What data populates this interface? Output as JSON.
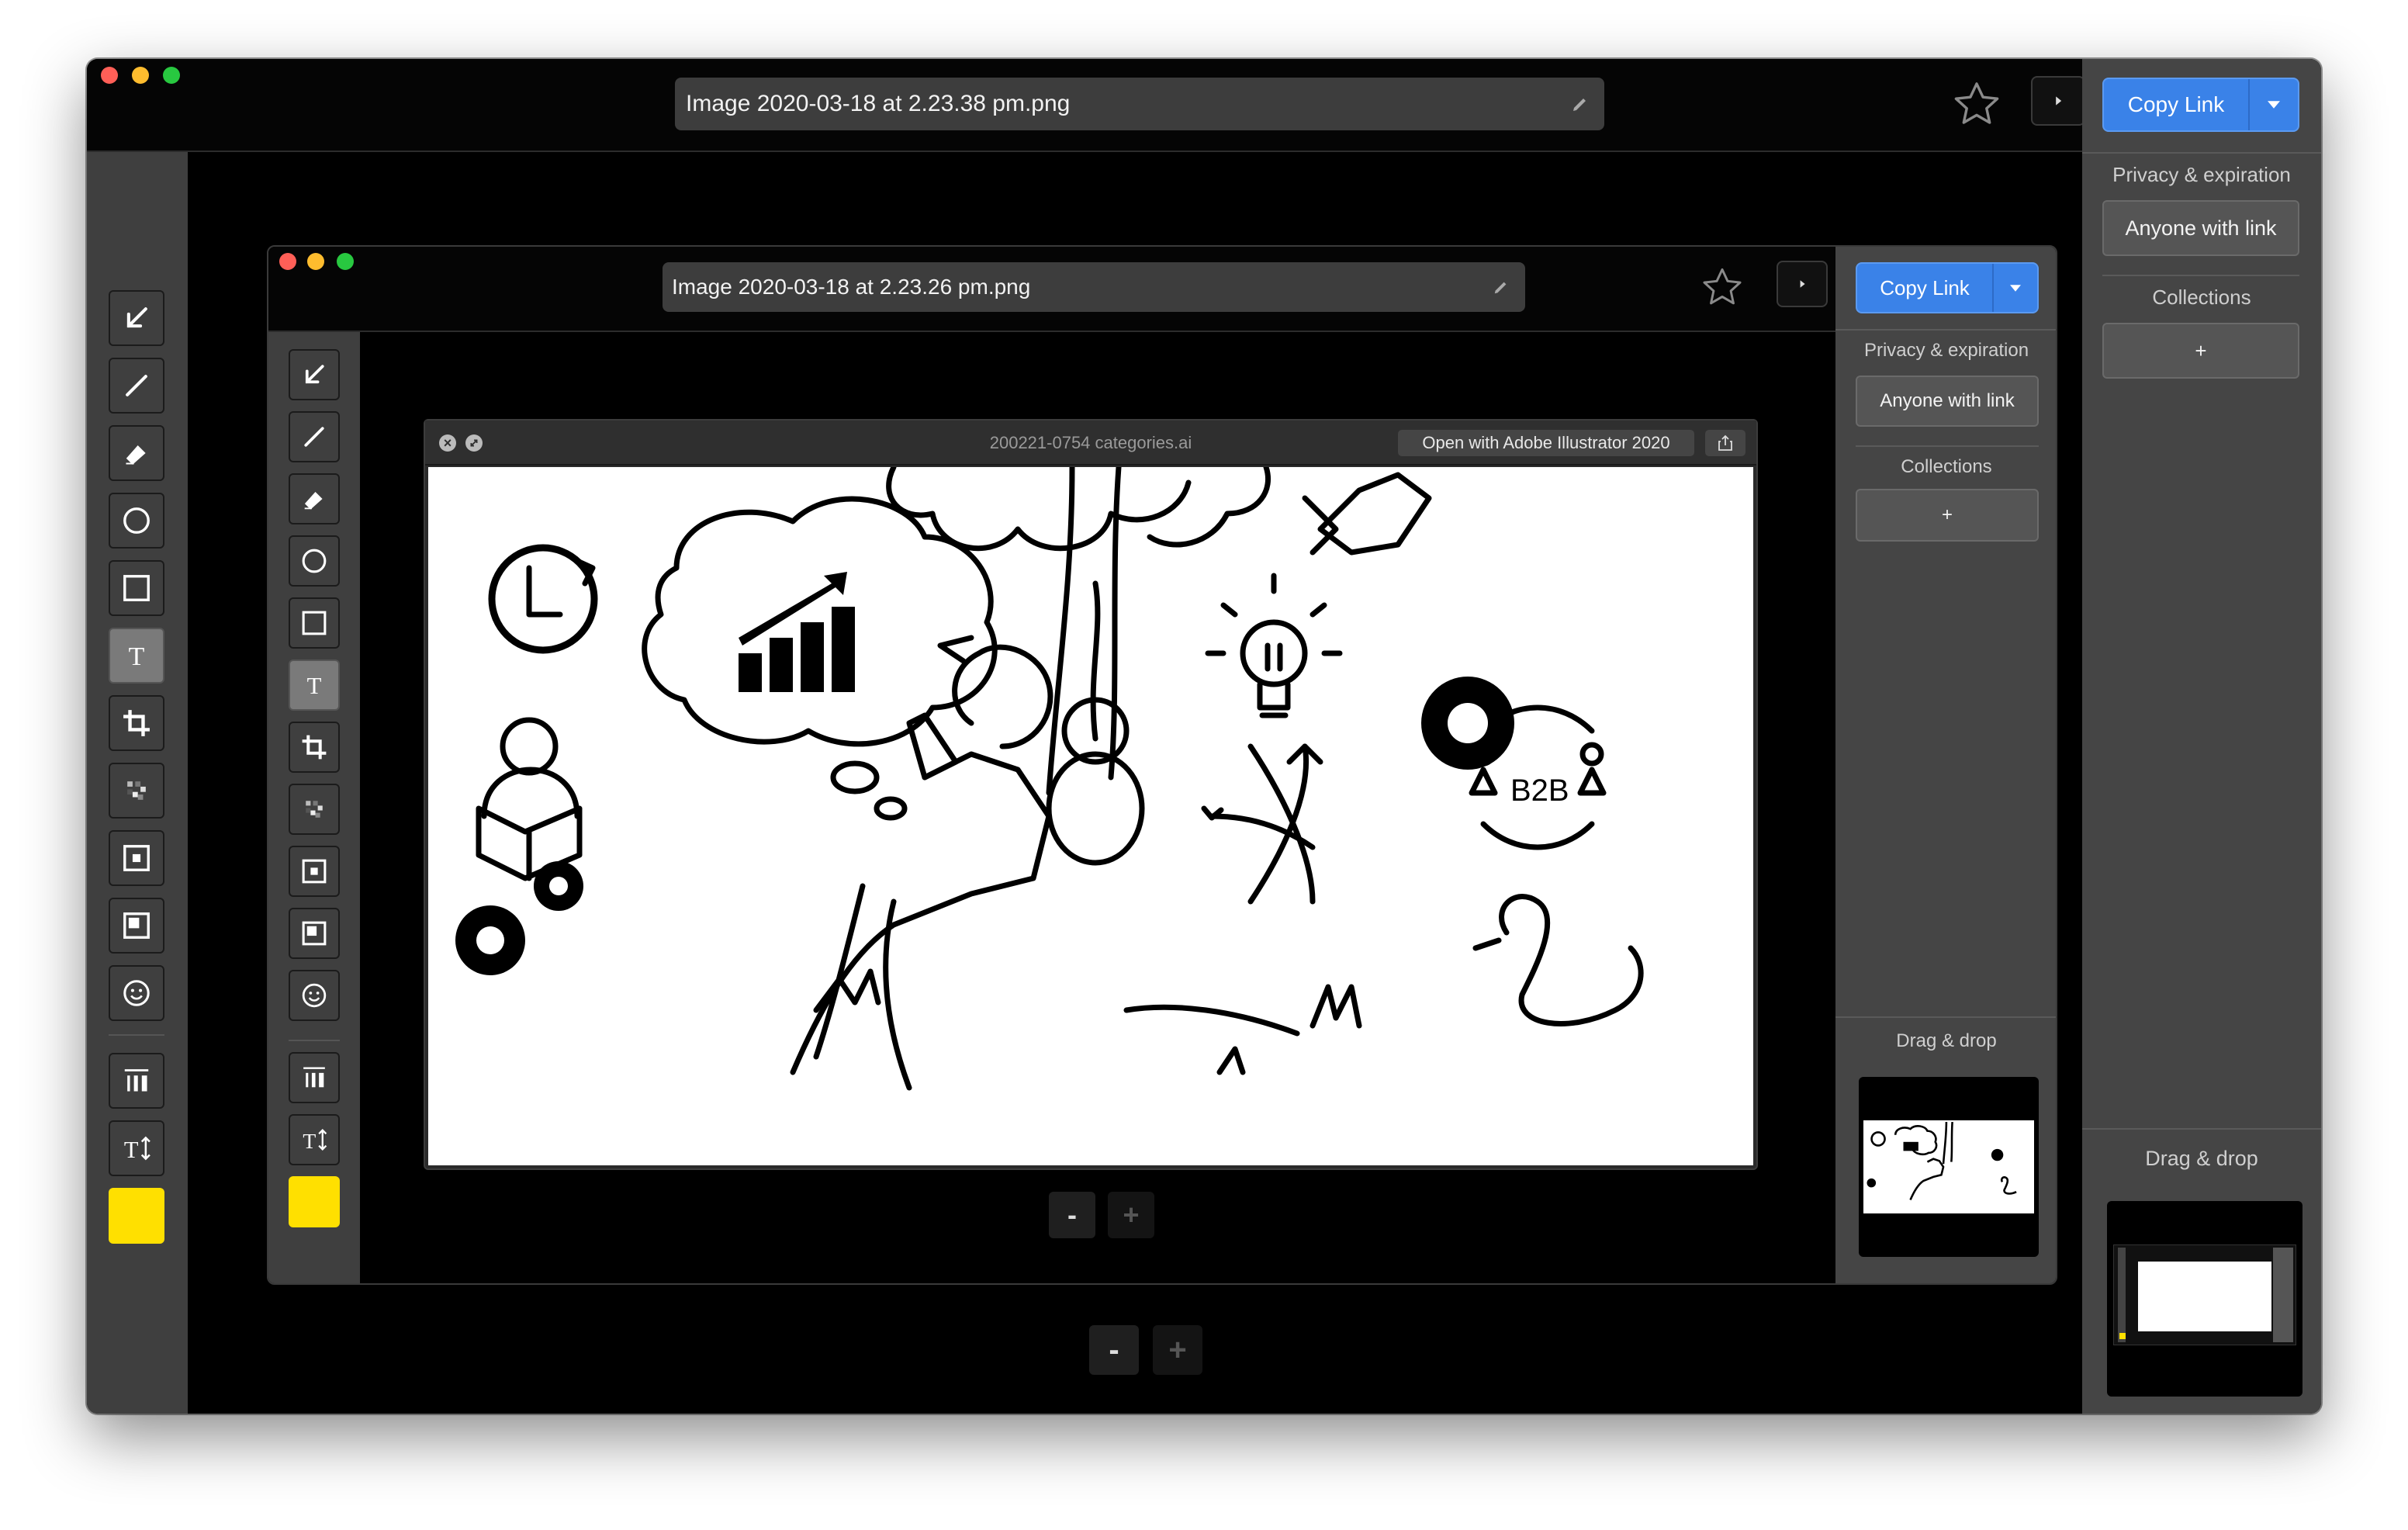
{
  "outer": {
    "filename": "Image 2020-03-18 at 2.23.38 pm.png",
    "copy_link": "Copy Link",
    "privacy_title": "Privacy & expiration",
    "privacy_value": "Anyone with link",
    "collections_title": "Collections",
    "collections_add": "+",
    "dragdrop": "Drag & drop",
    "zoom_out": "-",
    "zoom_in": "+"
  },
  "inner": {
    "filename": "Image 2020-03-18 at 2.23.26 pm.png",
    "copy_link": "Copy Link",
    "privacy_title": "Privacy & expiration",
    "privacy_value": "Anyone with link",
    "collections_title": "Collections",
    "collections_add": "+",
    "dragdrop": "Drag & drop",
    "zoom_out": "-",
    "zoom_in": "+"
  },
  "preview": {
    "title": "200221-0754 categories.ai",
    "open_with": "Open with Adobe Illustrator 2020"
  },
  "illustration": {
    "badge_text": "B2B"
  },
  "tools": [
    "arrow-tool",
    "line-tool",
    "highlighter-tool",
    "ellipse-tool",
    "rectangle-tool",
    "text-tool",
    "crop-tool",
    "pixelate-tool",
    "spotlight-tool",
    "blur-tool",
    "emoji-tool",
    "line-width-tool",
    "font-size-tool",
    "color-swatch"
  ],
  "colors": {
    "accent": "#3a82e8",
    "swatch": "#ffe000",
    "panel": "#454545",
    "toolbar": "#3f3f3f"
  }
}
